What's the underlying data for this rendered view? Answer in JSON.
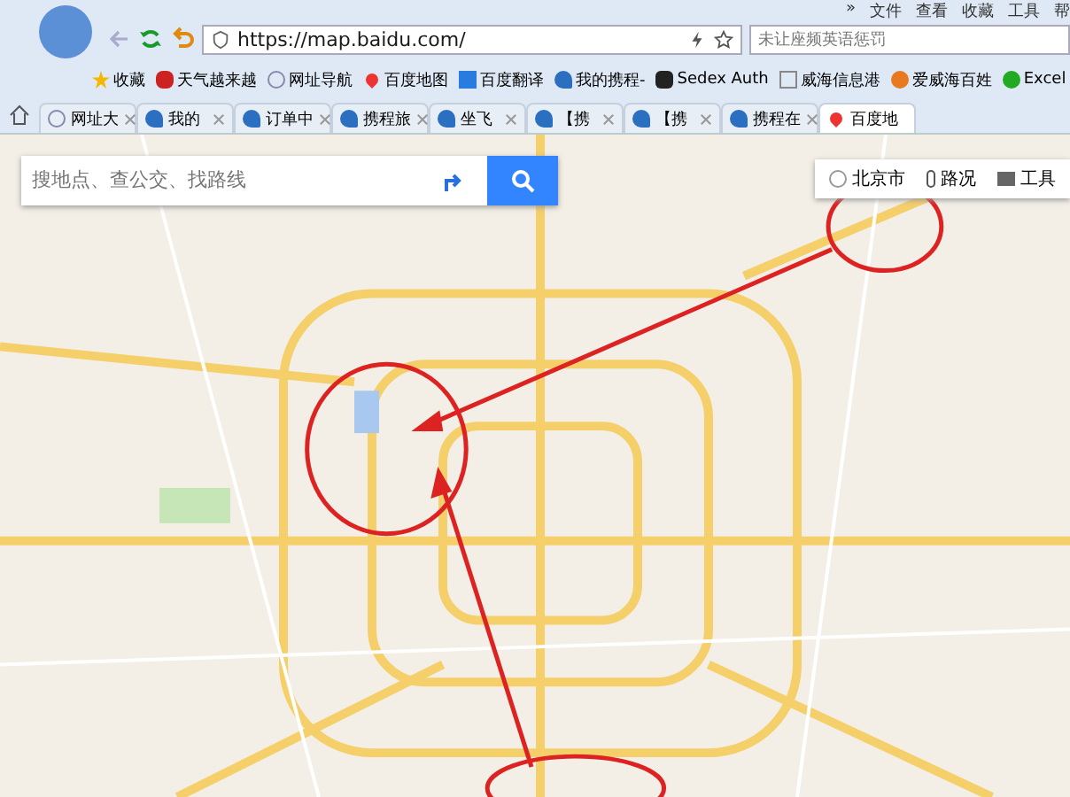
{
  "menu": [
    "»",
    "文件",
    "查看",
    "收藏",
    "工具",
    "帮"
  ],
  "address_bar": {
    "url": "https://map.baidu.com/"
  },
  "search_field": {
    "placeholder": "未让座频英语惩罚"
  },
  "bookmarks": [
    {
      "label": "收藏",
      "kind": "star"
    },
    {
      "label": "天气越来越",
      "kind": "flower"
    },
    {
      "label": "网址导航",
      "kind": "globe"
    },
    {
      "label": "百度地图",
      "kind": "pin"
    },
    {
      "label": "百度翻译",
      "kind": "translate"
    },
    {
      "label": "我的携程-",
      "kind": "dolphin"
    },
    {
      "label": "Sedex Auth",
      "kind": "s"
    },
    {
      "label": "威海信息港",
      "kind": "page"
    },
    {
      "label": "爱威海百姓",
      "kind": "ribbon"
    },
    {
      "label": "Excel",
      "kind": "cloud"
    }
  ],
  "tabs": [
    {
      "label": "网址大",
      "kind": "globe",
      "selected": false
    },
    {
      "label": "我的",
      "kind": "dolphin",
      "selected": false
    },
    {
      "label": "订单中",
      "kind": "dolphin",
      "selected": false
    },
    {
      "label": "携程旅",
      "kind": "dolphin",
      "selected": false
    },
    {
      "label": "坐飞",
      "kind": "dolphin",
      "selected": false
    },
    {
      "label": "【携",
      "kind": "dolphin",
      "selected": false
    },
    {
      "label": "【携",
      "kind": "dolphin",
      "selected": false
    },
    {
      "label": "携程在",
      "kind": "dolphin",
      "selected": false
    },
    {
      "label": "百度地",
      "kind": "pin",
      "selected": true
    }
  ],
  "map_search": {
    "placeholder": "搜地点、查公交、找路线"
  },
  "map_tools": [
    {
      "label": "北京市",
      "kind": "city"
    },
    {
      "label": "路况",
      "kind": "traffic"
    },
    {
      "label": "工具",
      "kind": "toolbox"
    }
  ]
}
